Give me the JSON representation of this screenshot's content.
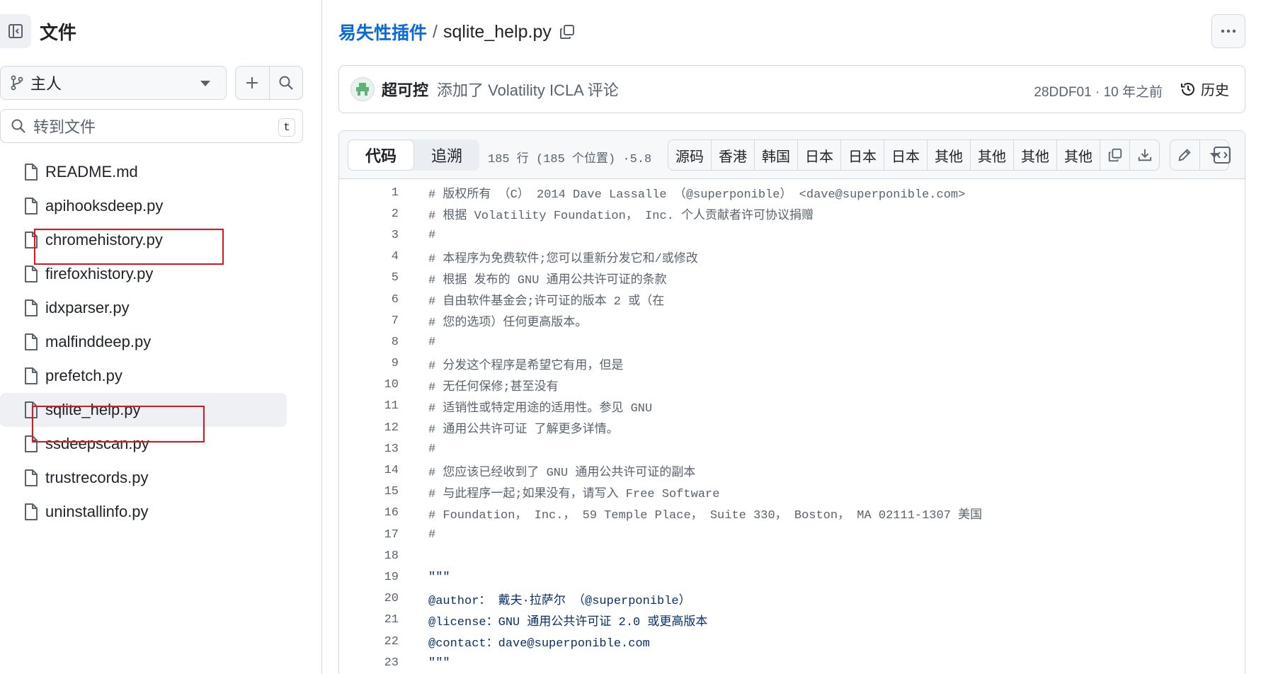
{
  "sidebar": {
    "title": "文件",
    "branch": "主人",
    "goto_placeholder": "转到文件",
    "goto_shortcut": "t",
    "files": [
      "README.md",
      "apihooksdeep.py",
      "chromehistory.py",
      "firefoxhistory.py",
      "idxparser.py",
      "malfinddeep.py",
      "prefetch.py",
      "sqlite_help.py",
      "ssdeepscan.py",
      "trustrecords.py",
      "uninstallinfo.py"
    ],
    "active_file": "sqlite_help.py"
  },
  "breadcrumb": {
    "repo": "易失性插件",
    "separator": "/",
    "file": "sqlite_help.py"
  },
  "commit": {
    "author": "超可控",
    "message": "添加了 Volatility ICLA 评论",
    "meta": "28DDF01 · 10 年之前",
    "history_label": "历史"
  },
  "toolbar": {
    "tab_code": "代码",
    "tab_blame": "追溯",
    "file_info": "185 行 (185 个位置) ·5.8",
    "buttons": [
      "源码",
      "香港",
      "韩国",
      "日本",
      "日本",
      "日本",
      "其他",
      "其他",
      "其他",
      "其他"
    ]
  },
  "code_lines": [
    {
      "n": "1",
      "text": "# 版权所有 （C） 2014 Dave Lassalle （@superponible） <dave@superponible.com>",
      "doc": false
    },
    {
      "n": "2",
      "text": "# 根据 Volatility Foundation， Inc. 个人贡献者许可协议捐赠",
      "doc": false
    },
    {
      "n": "3",
      "text": "#",
      "doc": false
    },
    {
      "n": "4",
      "text": "# 本程序为免费软件;您可以重新分发它和/或修改",
      "doc": false
    },
    {
      "n": "5",
      "text": "# 根据 发布的 GNU 通用公共许可证的条款",
      "doc": false
    },
    {
      "n": "6",
      "text": "# 自由软件基金会;许可证的版本 2 或（在",
      "doc": false
    },
    {
      "n": "7",
      "text": "# 您的选项）任何更高版本。",
      "doc": false
    },
    {
      "n": "8",
      "text": "#",
      "doc": false
    },
    {
      "n": "9",
      "text": "# 分发这个程序是希望它有用，但是",
      "doc": false
    },
    {
      "n": "10",
      "text": "# 无任何保修;甚至没有",
      "doc": false
    },
    {
      "n": "11",
      "text": "# 适销性或特定用途的适用性。参见 GNU",
      "doc": false
    },
    {
      "n": "12",
      "text": "# 通用公共许可证 了解更多详情。",
      "doc": false
    },
    {
      "n": "13",
      "text": "#",
      "doc": false
    },
    {
      "n": "14",
      "text": "# 您应该已经收到了 GNU 通用公共许可证的副本",
      "doc": false
    },
    {
      "n": "15",
      "text": "# 与此程序一起;如果没有，请写入 Free Software",
      "doc": false
    },
    {
      "n": "16",
      "text": "# Foundation， Inc.， 59 Temple Place， Suite 330， Boston， MA 02111-1307 美国",
      "doc": false
    },
    {
      "n": "17",
      "text": "#",
      "doc": false
    },
    {
      "n": "18",
      "text": "",
      "doc": false
    },
    {
      "n": "19",
      "text": "\"\"\"",
      "doc": true
    },
    {
      "n": "20",
      "text": "@author： 戴夫·拉萨尔 （@superponible）",
      "doc": true
    },
    {
      "n": "21",
      "text": "@license：GNU 通用公共许可证 2.0 或更高版本",
      "doc": true
    },
    {
      "n": "22",
      "text": "@contact：dave@superponible.com",
      "doc": true
    },
    {
      "n": "23",
      "text": "\"\"\"",
      "doc": true
    }
  ]
}
